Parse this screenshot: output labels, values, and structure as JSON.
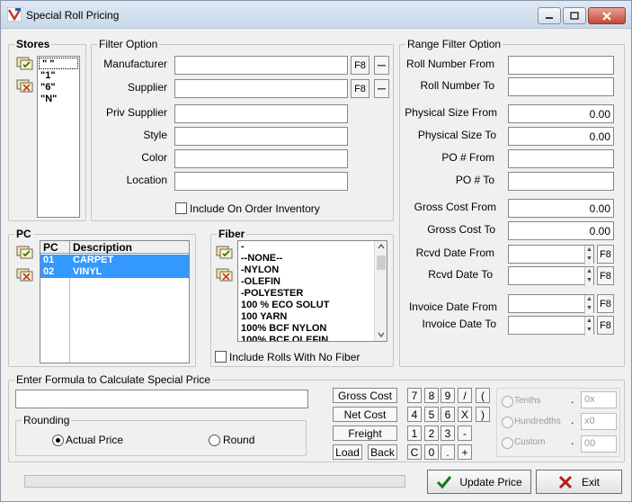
{
  "window": {
    "title": "Special Roll Pricing",
    "minimize": "▭",
    "maximize": "□",
    "close": "✕"
  },
  "stores": {
    "title": "Stores",
    "items": [
      "\" \"",
      "\"1\"",
      "\"6\"",
      "\"N\""
    ]
  },
  "filter": {
    "title": "Filter Option",
    "manufacturer_label": "Manufacturer",
    "supplier_label": "Supplier",
    "priv_supplier_label": "Priv Supplier",
    "style_label": "Style",
    "color_label": "Color",
    "location_label": "Location",
    "f8": "F8",
    "dash": "...",
    "include_on_order": "Include On Order Inventory"
  },
  "range": {
    "title": "Range Filter Option",
    "roll_from_label": "Roll Number From",
    "roll_to_label": "Roll Number To",
    "phys_from_label": "Physical Size From",
    "phys_from_value": "0.00",
    "phys_to_label": "Physical Size To",
    "phys_to_value": "0.00",
    "po_from_label": "PO # From",
    "po_to_label": "PO # To",
    "gross_from_label": "Gross Cost From",
    "gross_from_value": "0.00",
    "gross_to_label": "Gross Cost To",
    "gross_to_value": "0.00",
    "rcvd_from_label": "Rcvd Date From",
    "rcvd_to_label": "Rcvd Date To",
    "inv_from_label": "Invoice Date From",
    "inv_to_label": "Invoice Date To",
    "f8": "F8"
  },
  "pc": {
    "title": "PC",
    "col_pc": "PC",
    "col_desc": "Description",
    "rows": [
      {
        "pc": "01",
        "desc": "CARPET"
      },
      {
        "pc": "02",
        "desc": "VINYL"
      }
    ]
  },
  "fiber": {
    "title": "Fiber",
    "items": [
      "-",
      "--NONE--",
      "-NYLON",
      "-OLEFIN",
      "-POLYESTER",
      "100 % ECO SOLUT",
      "100 YARN",
      "100% BCF NYLON",
      "100% BCF OLEFIN"
    ],
    "include_no_fiber": "Include Rolls With No Fiber"
  },
  "formula": {
    "title": "Enter Formula to Calculate Special Price",
    "value": "",
    "rounding_title": "Rounding",
    "actual_price": "Actual Price",
    "round": "Round",
    "gross_cost": "Gross Cost",
    "net_cost": "Net Cost",
    "freight": "Freight",
    "load": "Load",
    "back": "Back",
    "keys_row1": [
      "7",
      "8",
      "9",
      "/",
      "("
    ],
    "keys_row2": [
      "4",
      "5",
      "6",
      "X",
      ")"
    ],
    "keys_row3": [
      "1",
      "2",
      "3",
      "-"
    ],
    "keys_row4": [
      "C",
      "0",
      ".",
      "+"
    ],
    "tenths": "Tenths",
    "hundredths": "Hundredths",
    "custom": "Custom",
    "tenths_value": "0x",
    "hundredths_value": "x0",
    "custom_value": "00",
    "dot": "."
  },
  "footer": {
    "update_price": "Update Price",
    "exit": "Exit"
  },
  "colors": {
    "selection": "#3399ff",
    "title_gradient_top": "#dfe9f5",
    "close_red": "#c54a32"
  }
}
